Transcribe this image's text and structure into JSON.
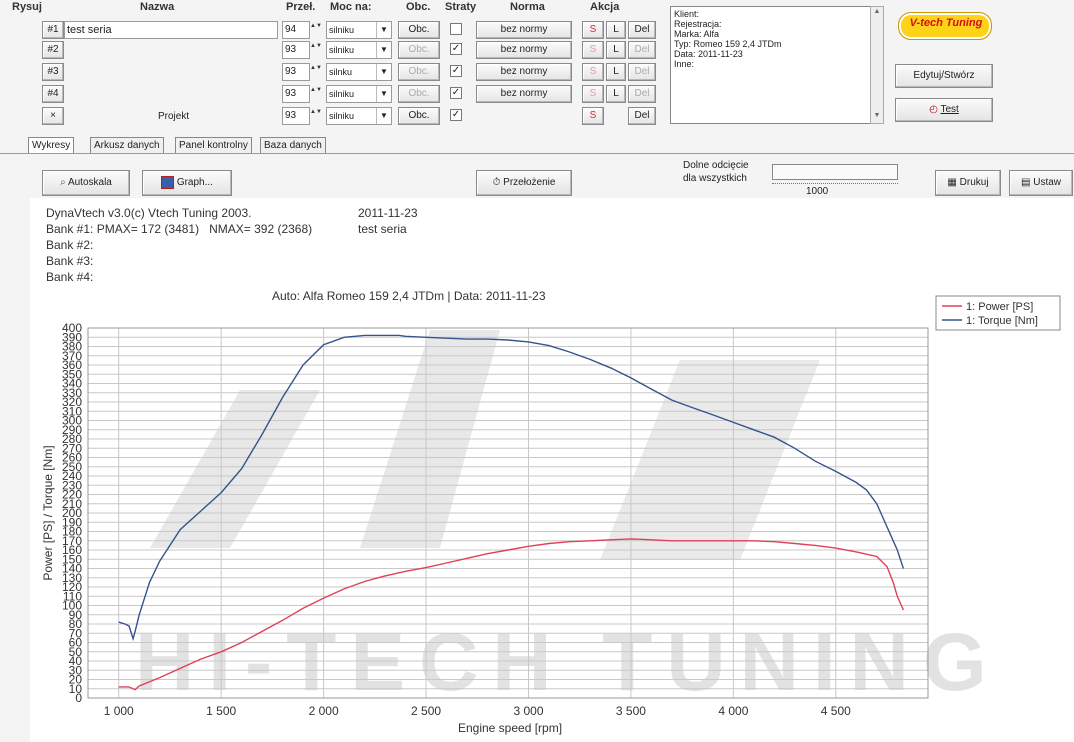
{
  "columns": {
    "rysuj": "Rysuj",
    "nazwa": "Nazwa",
    "przel": "Przeł.",
    "moc": "Moc na:",
    "obc": "Obc.",
    "straty": "Straty",
    "norma": "Norma",
    "akcja": "Akcja"
  },
  "banks": [
    {
      "label": "#1",
      "name": "test seria",
      "przel": "94",
      "moc": "silniku",
      "obc": "Obc.",
      "straty": false,
      "norma": "bez normy",
      "s": "S",
      "l": "L",
      "del": "Del"
    },
    {
      "label": "#2",
      "name": "",
      "przel": "93",
      "moc": "silniku",
      "obc": "Obc.",
      "straty": true,
      "norma": "bez normy",
      "s": "S",
      "l": "L",
      "del": "Del"
    },
    {
      "label": "#3",
      "name": "",
      "przel": "93",
      "moc": "silnku",
      "obc": "Obc.",
      "straty": true,
      "norma": "bez normy",
      "s": "S",
      "l": "L",
      "del": "Del"
    },
    {
      "label": "#4",
      "name": "",
      "przel": "93",
      "moc": "silniku",
      "obc": "Obc.",
      "straty": true,
      "norma": "bez normy",
      "s": "S",
      "l": "L",
      "del": "Del"
    }
  ],
  "project_row": {
    "label": "×",
    "name": "Projekt",
    "przel": "93",
    "moc": "silniku",
    "obc": "Obc.",
    "straty": true,
    "s": "S",
    "del": "Del"
  },
  "info": {
    "lines": [
      "Klient:",
      "Rejestracja:",
      "Marka: Alfa",
      "Typ: Romeo 159 2,4 JTDm",
      "Data: 2011-11-23",
      "Inne:"
    ]
  },
  "logo": "V-tech Tuning",
  "edit_button": "Edytuj/Stwórz",
  "test_button": "Test",
  "tabs": [
    "Wykresy",
    "Arkusz danych",
    "Panel kontrolny",
    "Baza danych"
  ],
  "toolbar": {
    "autoscale": "Autoskala",
    "graph": "Graph...",
    "gear": "Przełożenie",
    "cutoff_label1": "Dolne odcięcie",
    "cutoff_label2": "dla wszystkich",
    "cutoff_value": "1000",
    "print": "Drukuj",
    "settings": "Ustaw"
  },
  "chart_header": {
    "line1a": "DynaVtech v3.0(c) Vtech Tuning 2003.",
    "line1b": "2011-11-23",
    "line2a": "Bank #1: PMAX= 172 (3481)   NMAX= 392 (2368)",
    "line2b": "test seria",
    "bank2": "Bank #2:",
    "bank3": "Bank #3:",
    "bank4": "Bank #4:",
    "auto": "Auto: Alfa Romeo 159 2,4 JTDm | Data: 2011-11-23"
  },
  "watermark": "HI-TECH TUNING",
  "colors": {
    "power": "#e0405a",
    "torque": "#34548e",
    "accent": "#d02020",
    "grid": "#c8c8c8"
  },
  "chart_data": {
    "type": "line",
    "xlabel": "Engine speed [rpm]",
    "ylabel": "Power [PS] / Torque [Nm]",
    "xlim": [
      850,
      4950
    ],
    "ylim": [
      0,
      400
    ],
    "xticks": [
      1000,
      1500,
      2000,
      2500,
      3000,
      3500,
      4000,
      4500
    ],
    "xtick_labels": [
      "1 000",
      "1 500",
      "2 000",
      "2 500",
      "3 000",
      "3 500",
      "4 000",
      "4 500"
    ],
    "yticks": [
      0,
      10,
      20,
      30,
      40,
      50,
      60,
      70,
      80,
      90,
      100,
      110,
      120,
      130,
      140,
      150,
      160,
      170,
      180,
      190,
      200,
      210,
      220,
      230,
      240,
      250,
      260,
      270,
      280,
      290,
      300,
      310,
      320,
      330,
      340,
      350,
      360,
      370,
      380,
      390,
      400
    ],
    "ytick_labels": [
      "0",
      "10",
      "20",
      "30",
      "40",
      "50",
      "60",
      "70",
      "80",
      "90",
      "100",
      "110",
      "120",
      "130",
      "140",
      "150",
      "160",
      "170",
      "180",
      "190",
      "200",
      "210",
      "220",
      "230",
      "240",
      "250",
      "260",
      "270",
      "280",
      "290",
      "300",
      "310",
      "320",
      "330",
      "340",
      "350",
      "360",
      "370",
      "380",
      "390",
      "400"
    ],
    "grid": true,
    "legend_position": "top-right",
    "series": [
      {
        "name": "1: Power [PS]",
        "x": [
          1000,
          1050,
          1080,
          1100,
          1200,
          1300,
          1400,
          1500,
          1600,
          1700,
          1800,
          1900,
          2000,
          2100,
          2200,
          2300,
          2400,
          2500,
          2600,
          2700,
          2800,
          2900,
          3000,
          3100,
          3200,
          3300,
          3400,
          3500,
          3600,
          3700,
          3800,
          3900,
          4000,
          4100,
          4200,
          4300,
          4400,
          4500,
          4600,
          4700,
          4750,
          4780,
          4800,
          4830
        ],
        "y": [
          12,
          12,
          9,
          13,
          22,
          32,
          42,
          50,
          60,
          72,
          84,
          97,
          108,
          118,
          126,
          132,
          137,
          141,
          146,
          151,
          156,
          160,
          164,
          167,
          169,
          170,
          171,
          172,
          171,
          170,
          170,
          170,
          170,
          170,
          169,
          167,
          165,
          162,
          158,
          153,
          142,
          125,
          110,
          95
        ]
      },
      {
        "name": "1: Torque [Nm]",
        "x": [
          1000,
          1030,
          1050,
          1070,
          1080,
          1100,
          1150,
          1200,
          1300,
          1400,
          1500,
          1600,
          1700,
          1800,
          1900,
          2000,
          2100,
          2200,
          2300,
          2368,
          2400,
          2500,
          2600,
          2700,
          2800,
          2900,
          3000,
          3100,
          3200,
          3300,
          3400,
          3500,
          3600,
          3700,
          3800,
          3900,
          4000,
          4100,
          4200,
          4300,
          4400,
          4500,
          4600,
          4650,
          4700,
          4750,
          4800,
          4830
        ],
        "y": [
          82,
          80,
          78,
          64,
          72,
          90,
          125,
          148,
          182,
          202,
          222,
          248,
          285,
          325,
          360,
          382,
          390,
          392,
          392,
          392,
          391,
          390,
          389,
          388,
          388,
          387,
          385,
          381,
          374,
          366,
          357,
          346,
          334,
          322,
          314,
          306,
          298,
          290,
          282,
          270,
          256,
          245,
          233,
          225,
          210,
          185,
          160,
          140
        ]
      }
    ]
  }
}
